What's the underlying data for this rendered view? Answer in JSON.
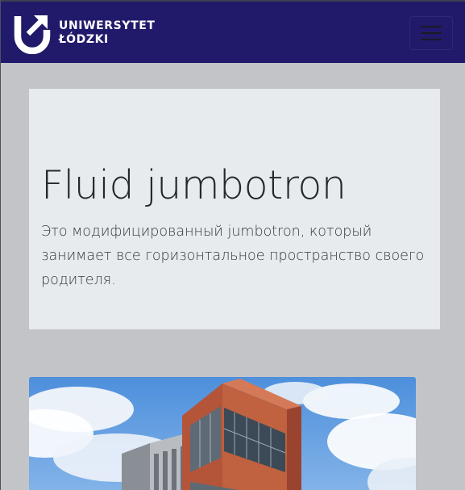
{
  "navbar": {
    "brand_line1": "UNIWERSYTET",
    "brand_line2": "ŁÓDZKI",
    "logo_icon": "ul-logo-icon",
    "menu_icon": "hamburger-menu-icon",
    "background": "#211a6b"
  },
  "jumbotron": {
    "title": "Fluid jumbotron",
    "lead": "Это модифицированный jumbotron, который занимает все горизонтальное пространство своего родителя.",
    "background": "#e8ebee"
  },
  "photo": {
    "subject": "building-photo"
  }
}
